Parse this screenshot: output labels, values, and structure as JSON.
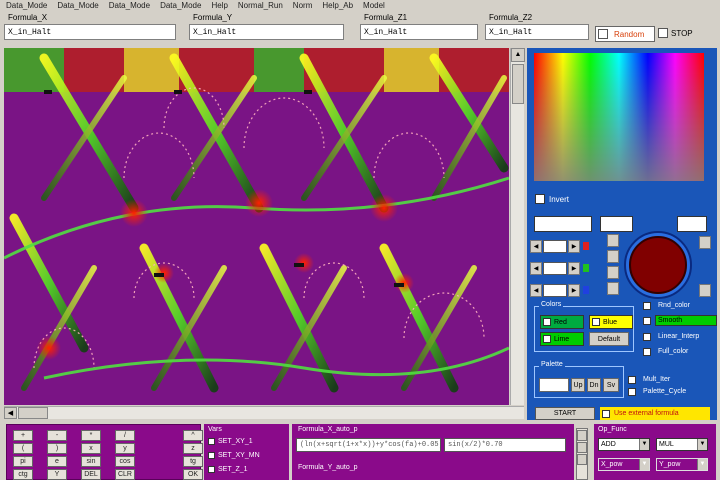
{
  "menu": [
    "Data_Mode",
    "Data_Mode",
    "Data_Mode",
    "Data_Mode",
    "Help",
    "Normal_Run",
    "Norm",
    "Help_Ab",
    "Model"
  ],
  "formulas": [
    {
      "label": "Formula_X",
      "value": "X_in_Halt"
    },
    {
      "label": "Formula_Y",
      "value": "X_in_Halt"
    },
    {
      "label": "Formula_Z1",
      "value": "X_in_Halt"
    },
    {
      "label": "Formula_Z2",
      "value": "X_in_Halt"
    }
  ],
  "random_label": "Random",
  "stop_label": "STOP",
  "right_panel": {
    "colors": {
      "panel": "#1a56b8",
      "selected_color": "#800000"
    },
    "invert_label": "Invert",
    "groups": {
      "colors_title": "Colors",
      "palette_title": "Palette",
      "swatches": [
        {
          "label": "Red",
          "color": "#ffffff"
        },
        {
          "label": "Blue",
          "color": "#ffff00"
        },
        {
          "label": "Lime",
          "color": "#00cc00"
        }
      ],
      "default_label": "Default",
      "palette_buttons": [
        "Up",
        "Dn",
        "Sv"
      ],
      "options": [
        {
          "label": "Rnd_color",
          "bar": ""
        },
        {
          "label": "",
          "bar": "Smooth",
          "bar_color": "#00cc00"
        },
        {
          "label": "Linear_Interp",
          "bar": ""
        },
        {
          "label": "Full_color",
          "bar": ""
        },
        {
          "label": "Mult_Iter",
          "bar": ""
        },
        {
          "label": "Palette_Cycle",
          "bar": ""
        }
      ]
    },
    "start_label": "START",
    "ext_formula_label": "Use external formula"
  },
  "keypad": {
    "keys": [
      "+",
      "-",
      "*",
      "/",
      "^",
      "(",
      ")",
      "x",
      "y",
      "z",
      "pi",
      "e",
      "sin",
      "cos",
      "tg",
      "ctg",
      "Y",
      "DEL",
      "CLR",
      "OK"
    ]
  },
  "vars": {
    "title": "Vars",
    "rows": [
      "SET_XY_1",
      "SET_XY_MN",
      "SET_Z_1"
    ]
  },
  "fx": {
    "label_a": "Formula_X_auto_p",
    "value_a": "(ln(x+sqrt(1+x*x))+y*cos(fa)+0.05)",
    "value_b": "sin(x/2)*0.70",
    "label_b": "Formula_Y_auto_p"
  },
  "ops": {
    "title": "Op_Func",
    "dd": [
      {
        "value": "ADD",
        "color": "#ffffff"
      },
      {
        "value": "MUL",
        "color": "#ffffff"
      },
      {
        "value": "X_pow",
        "color": "#8a0a8a"
      },
      {
        "value": "Y_pow",
        "color": "#8a0a8a"
      }
    ]
  }
}
